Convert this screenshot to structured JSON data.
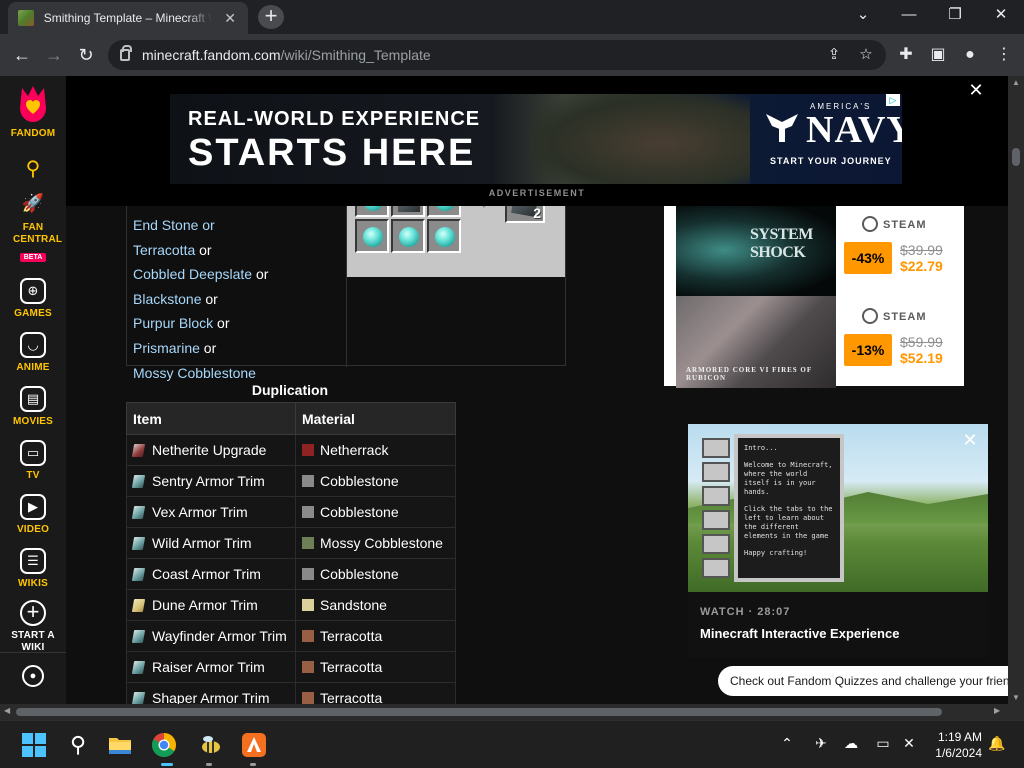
{
  "browser": {
    "tab_title": "Smithing Template – Minecraft Wiki",
    "tab_close": "✕",
    "new_tab": "+",
    "url_host": "minecraft.fandom.com",
    "url_path": "/wiki/Smithing_Template"
  },
  "rail": {
    "logo_label": "FANDOM",
    "items": [
      {
        "label": "FAN CENTRAL",
        "badge": "BETA"
      },
      {
        "label": "GAMES"
      },
      {
        "label": "ANIME"
      },
      {
        "label": "MOVIES"
      },
      {
        "label": "TV"
      },
      {
        "label": "VIDEO"
      },
      {
        "label": "WIKIS"
      },
      {
        "label": "START A WIKI"
      }
    ]
  },
  "ad": {
    "line1": "REAL-WORLD EXPERIENCE",
    "line2": "STARTS HERE",
    "brand_small": "AMERICA'S",
    "brand": "NAVY",
    "cta": "START YOUR JOURNEY",
    "label": "ADVERTISEMENT"
  },
  "recipe": {
    "partial": "End Stone or",
    "ingredients": [
      {
        "name": "Terracotta",
        "suffix": " or"
      },
      {
        "name": "Cobbled Deepslate",
        "suffix": " or"
      },
      {
        "name": "Blackstone",
        "suffix": " or"
      },
      {
        "name": "Purpur Block",
        "suffix": " or"
      },
      {
        "name": "Prismarine",
        "suffix": " or"
      },
      {
        "name": "Mossy Cobblestone",
        "suffix": ""
      }
    ],
    "output_count": "2"
  },
  "duplication": {
    "caption": "Duplication",
    "headers": [
      "Item",
      "Material"
    ],
    "rows": [
      {
        "item": "Netherite Upgrade",
        "material": "Netherrack",
        "swatch": "#8f2323"
      },
      {
        "item": "Sentry Armor Trim",
        "material": "Cobblestone",
        "swatch": "#8a8a8a"
      },
      {
        "item": "Vex Armor Trim",
        "material": "Cobblestone",
        "swatch": "#8a8a8a"
      },
      {
        "item": "Wild Armor Trim",
        "material": "Mossy Cobblestone",
        "swatch": "#6d7f56"
      },
      {
        "item": "Coast Armor Trim",
        "material": "Cobblestone",
        "swatch": "#8a8a8a"
      },
      {
        "item": "Dune Armor Trim",
        "material": "Sandstone",
        "swatch": "#dbd09c"
      },
      {
        "item": "Wayfinder Armor Trim",
        "material": "Terracotta",
        "swatch": "#985f45"
      },
      {
        "item": "Raiser Armor Trim",
        "material": "Terracotta",
        "swatch": "#985f45"
      },
      {
        "item": "Shaper Armor Trim",
        "material": "Terracotta",
        "swatch": "#985f45"
      }
    ]
  },
  "steam": {
    "store": "STEAM",
    "games": [
      {
        "name": "SYSTEM SHOCK",
        "discount": "-43%",
        "original": "$39.99",
        "sale": "$22.79"
      },
      {
        "name": "ARMORED CORE VI FIRES OF RUBICON",
        "discount": "-13%",
        "original": "$59.99",
        "sale": "$52.19"
      }
    ]
  },
  "video": {
    "meta": "WATCH · 28:07",
    "title": "Minecraft Interactive Experience",
    "panel_text": [
      "Intro...",
      "Welcome to Minecraft, where the world itself is in your hands.",
      "Click the tabs to the left to learn about the different elements in the game",
      "Happy crafting!"
    ]
  },
  "quiz": {
    "text": "Check out Fandom Quizzes and challenge your friends!"
  },
  "taskbar": {
    "time": "1:19 AM",
    "date": "1/6/2024"
  },
  "colors": {
    "fandom_yellow": "#ffc500",
    "fandom_pink": "#fa005a",
    "link_blue": "#a7d7f9",
    "steam_orange": "#ff9800"
  }
}
